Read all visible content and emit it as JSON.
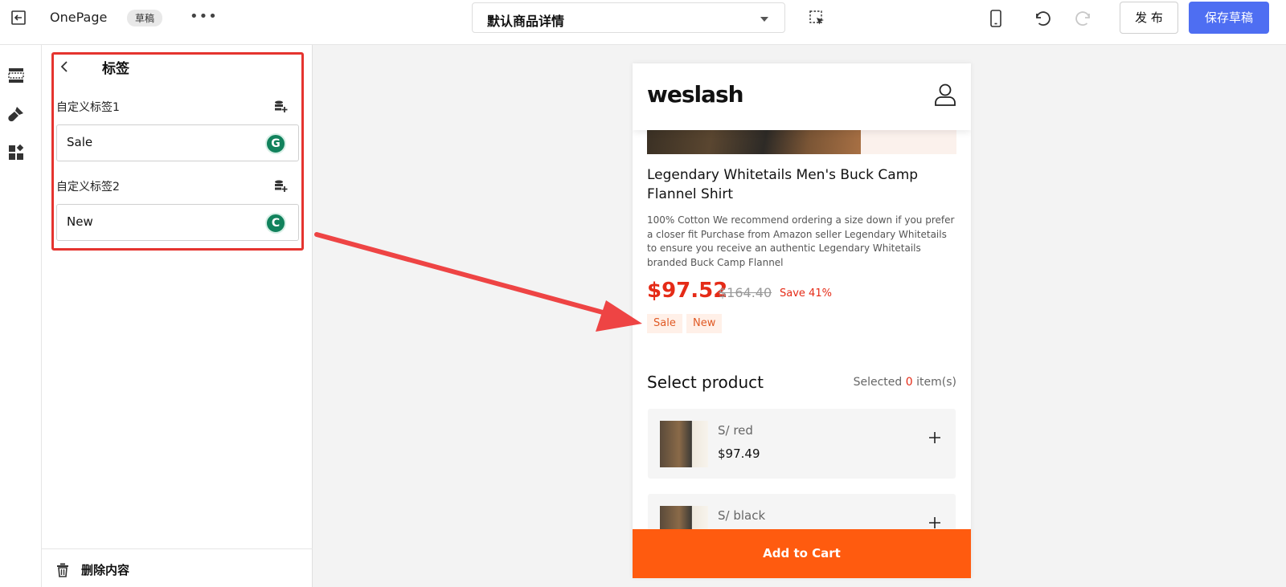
{
  "topbar": {
    "app_name": "OnePage",
    "status_badge": "草稿",
    "more_label": "•••",
    "template_select": "默认商品详情",
    "publish_label": "发 布",
    "save_draft_label": "保存草稿"
  },
  "panel": {
    "title": "标签",
    "fields": [
      {
        "label": "自定义标签1",
        "value": "Sale"
      },
      {
        "label": "自定义标签2",
        "value": "New"
      }
    ],
    "delete_label": "删除内容"
  },
  "preview": {
    "brand": "weslash",
    "product_title": "Legendary Whitetails Men's Buck Camp Flannel Shirt",
    "product_description": "100% Cotton We recommend ordering a size down if you prefer a closer fit Purchase from Amazon seller Legendary Whitetails to ensure you receive an authentic Legendary Whitetails branded Buck Camp Flannel",
    "price": "$97.52",
    "compare_price": "$164.40",
    "save_text": "Save 41%",
    "tags": [
      "Sale",
      "New"
    ],
    "select_heading": "Select product",
    "selected_prefix": "Selected",
    "selected_count": "0",
    "selected_suffix": "item(s)",
    "variants": [
      {
        "name": "S/ red",
        "price": "$97.49"
      },
      {
        "name": "S/ black",
        "price": ""
      }
    ],
    "add_to_cart": "Add to Cart"
  },
  "colors": {
    "accent": "#4e6ef2",
    "price_red": "#e52b17",
    "cta_orange": "#ff5b0f",
    "highlight_red": "#e5342f"
  },
  "icons": {
    "topbar": [
      "exit-icon",
      "select-element-icon",
      "mobile-device-icon",
      "undo-icon",
      "redo-icon"
    ],
    "rail": [
      "section-icon",
      "theme-brush-icon",
      "apps-icon"
    ],
    "panel": [
      "back-chevron-icon",
      "dynamic-source-icon",
      "grammarly-icon",
      "trash-icon"
    ],
    "preview": [
      "user-icon",
      "plus-icon"
    ]
  }
}
